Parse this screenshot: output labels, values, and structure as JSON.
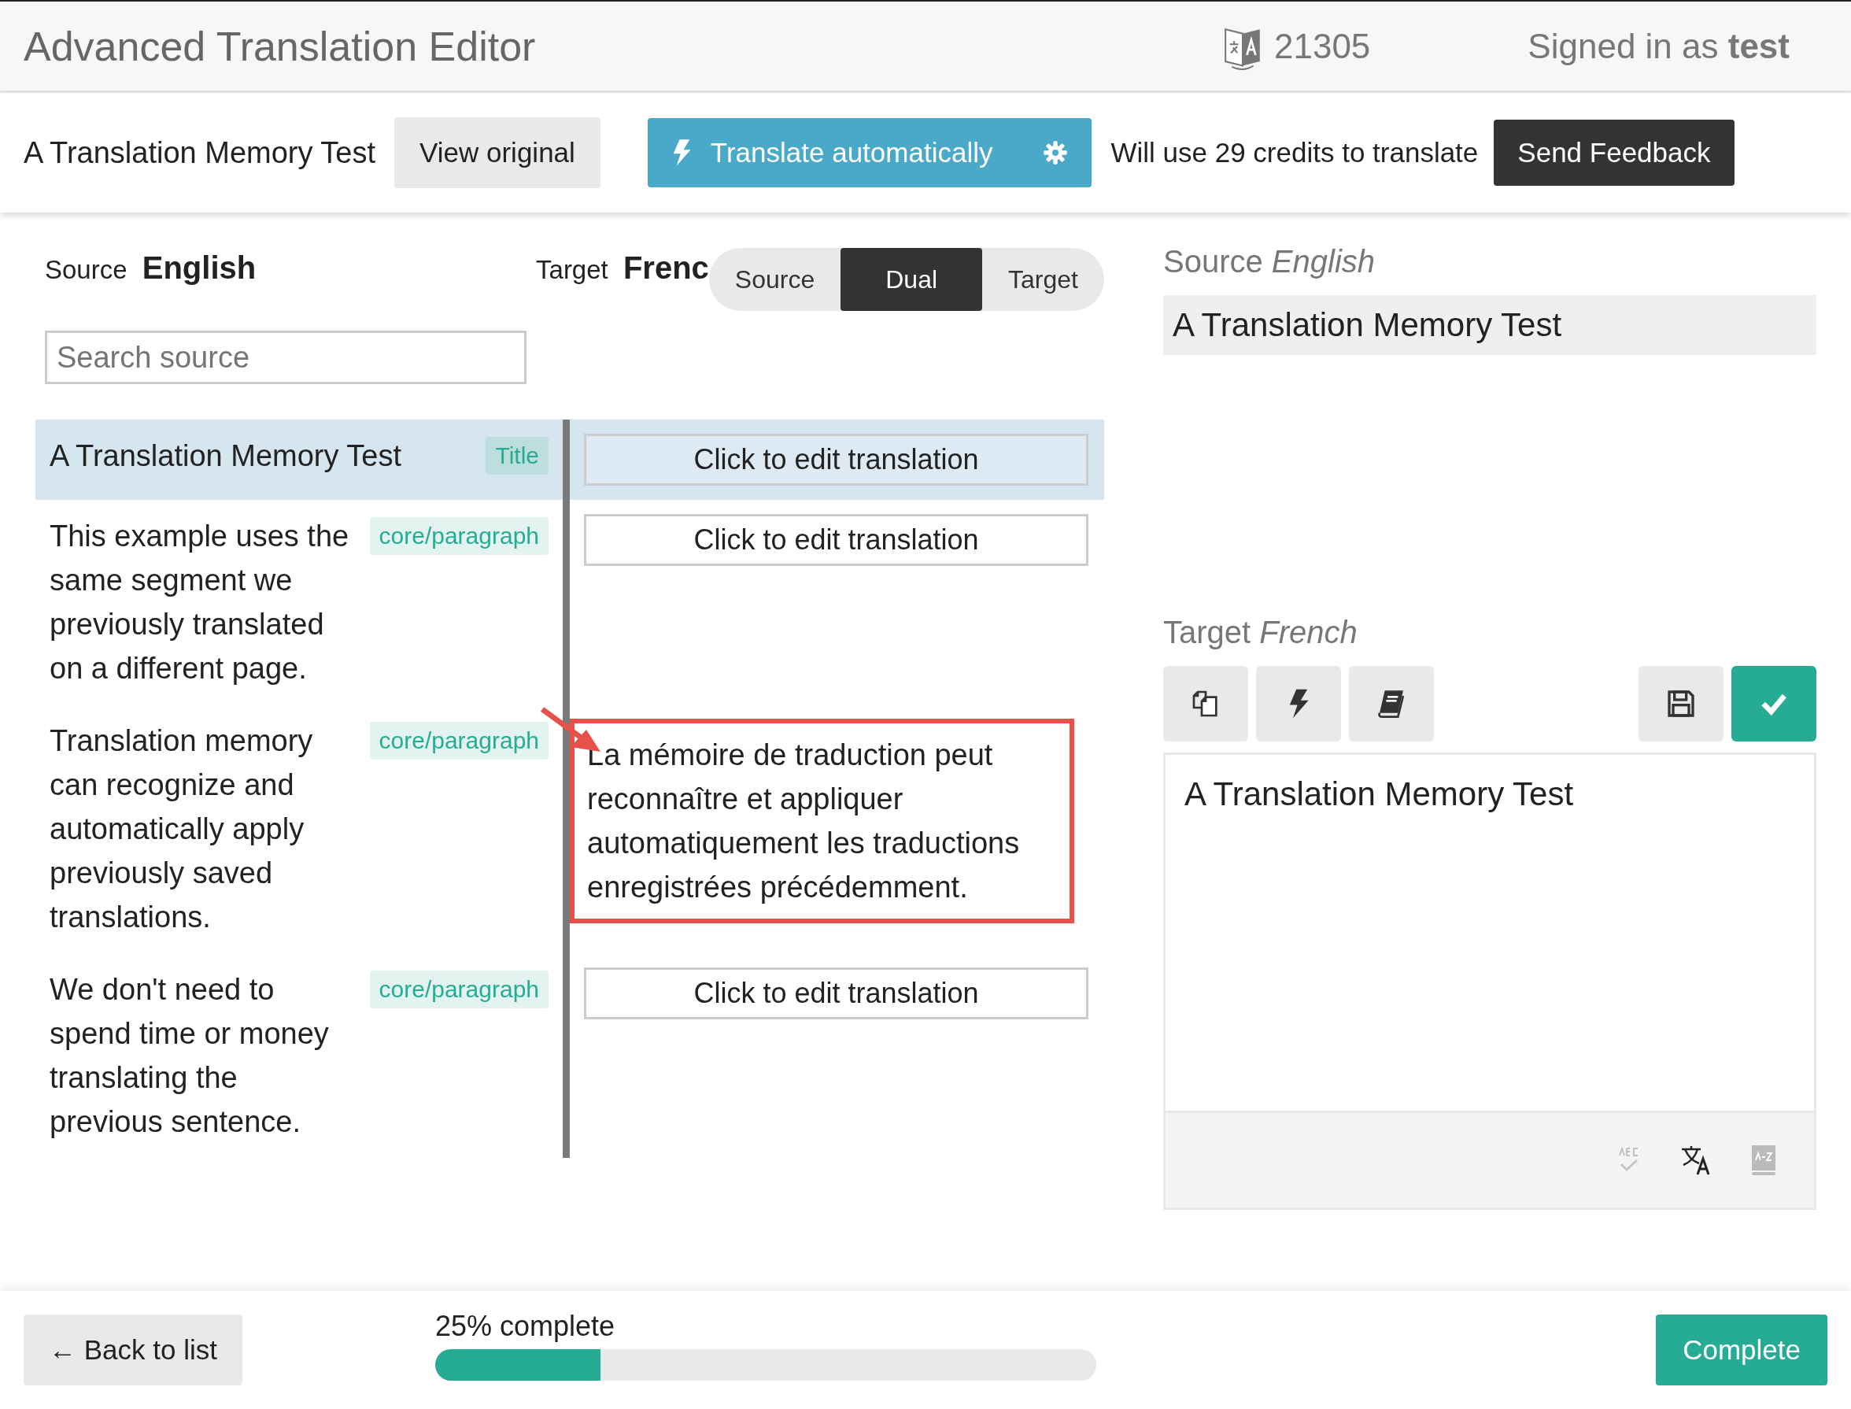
{
  "header": {
    "title": "Advanced Translation Editor",
    "credits": "21305",
    "signed_in_prefix": "Signed in as",
    "user": "test"
  },
  "toolbar": {
    "document_title": "A Translation Memory Test",
    "view_original": "View original",
    "translate_button": "Translate automatically",
    "credits_note": "Will use 29 credits to translate",
    "feedback_button": "Send Feedback"
  },
  "editor": {
    "source_label": "Source",
    "source_language": "English",
    "target_label": "Target",
    "target_language": "Frenc",
    "search": {
      "placeholder": "Search source"
    },
    "view_modes": [
      {
        "label": "Source",
        "selected": false
      },
      {
        "label": "Dual",
        "selected": true
      },
      {
        "label": "Target",
        "selected": false
      }
    ],
    "segments": [
      {
        "source": "A Translation Memory Test",
        "tag": "Title",
        "selected": true,
        "highlighted": false,
        "kind": "empty",
        "target": "Click to edit translation"
      },
      {
        "source": "This example uses the same segment we previously translated on a different page.",
        "tag": "core/paragraph",
        "selected": false,
        "highlighted": false,
        "kind": "empty",
        "target": "Click to edit translation"
      },
      {
        "source": "Translation memory can recognize and automatically apply previously saved translations.",
        "tag": "core/paragraph",
        "selected": false,
        "highlighted": true,
        "kind": "translated",
        "target": "La mémoire de traduction peut reconnaître et appliquer automatiquement les traductions enregistrées précédemment."
      },
      {
        "source": "We don't need to spend time or money translating the previous sentence.",
        "tag": "core/paragraph",
        "selected": false,
        "highlighted": false,
        "kind": "empty",
        "target": "Click to edit translation"
      }
    ]
  },
  "detail": {
    "source_label": "Source",
    "source_language": "English",
    "source_text": "A Translation Memory Test",
    "target_label": "Target",
    "target_language": "French",
    "target_text": "A Translation Memory Test"
  },
  "footer": {
    "back_button": "← Back to list",
    "progress_label": "25% complete",
    "progress": {
      "level": 0.25
    },
    "complete_button": "Complete"
  }
}
